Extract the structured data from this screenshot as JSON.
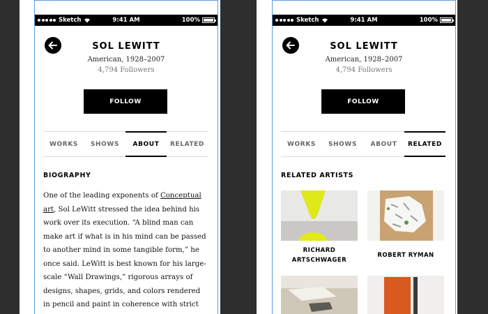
{
  "status_bar": {
    "carrier": "Sketch",
    "time": "9:41 AM",
    "battery": "100%",
    "battery_level": 1.0
  },
  "artist": {
    "name": "SOL LEWITT",
    "meta": "American, 1928–2007",
    "followers": "4,794 Followers"
  },
  "follow_label": "FOLLOW",
  "tabs": [
    "WORKS",
    "SHOWS",
    "ABOUT",
    "RELATED"
  ],
  "left_screen": {
    "active_tab": "ABOUT",
    "section_title": "BIOGRAPHY",
    "bio": {
      "before_link": "One of the leading exponents of ",
      "link": "Conceptual art",
      "after_link": ", Sol LeWitt stressed the idea behind his work over its execution. “A blind man can make art if what is in his mind can be passed to another mind in some tangible form,” he once said. LeWitt is best known for his large-scale “Wall Drawings,” rigorous arrays of designs, shapes, grids, and colors rendered in pencil and paint in coherence with strict instructions and"
    }
  },
  "right_screen": {
    "active_tab": "RELATED",
    "section_title": "RELATED ARTISTS",
    "related": [
      {
        "name_line1": "RICHARD",
        "name_line2": "ARTSCHWAGER"
      },
      {
        "name_line1": "ROBERT RYMAN",
        "name_line2": ""
      }
    ]
  },
  "colors": {
    "background": "#2e2e2e",
    "frame_outline": "#5a9be0",
    "accent": "#000000"
  },
  "icons": {
    "back": "arrow-left-icon",
    "wifi": "wifi-icon",
    "signal": "signal-dots-icon",
    "battery": "battery-icon"
  }
}
